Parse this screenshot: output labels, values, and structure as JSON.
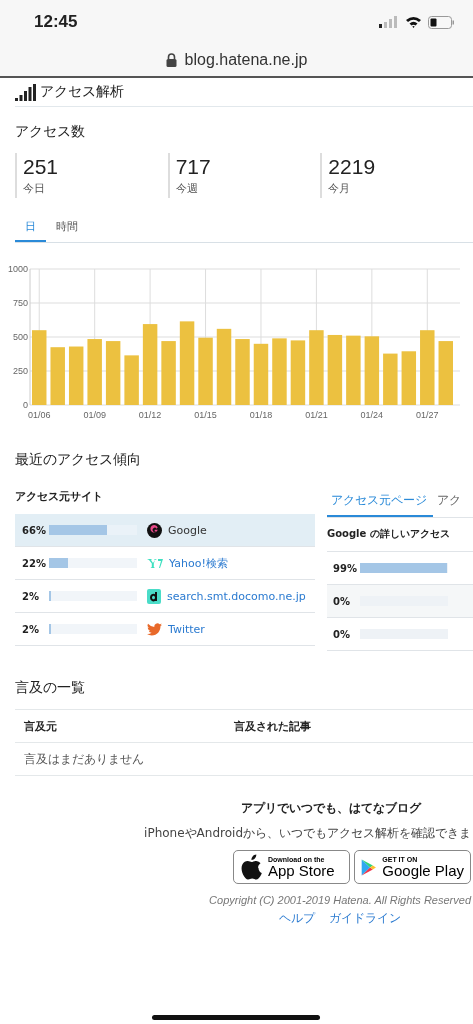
{
  "status_bar": {
    "time": "12:45"
  },
  "url_bar": {
    "url": "blog.hatena.ne.jp"
  },
  "header": {
    "title": "アクセス解析"
  },
  "access_count": {
    "title": "アクセス数",
    "stats": [
      {
        "value": "251",
        "label": "今日"
      },
      {
        "value": "717",
        "label": "今週"
      },
      {
        "value": "2219",
        "label": "今月"
      }
    ]
  },
  "tabs": [
    {
      "label": "日",
      "selected": true
    },
    {
      "label": "時間",
      "selected": false
    }
  ],
  "chart_data": {
    "type": "bar",
    "grid": true,
    "categories": [
      "01/06",
      null,
      null,
      "01/09",
      null,
      null,
      "01/12",
      null,
      null,
      "01/15",
      null,
      null,
      "01/18",
      null,
      null,
      "01/21",
      null,
      null,
      "01/24",
      null,
      null,
      "01/27",
      null
    ],
    "series": [
      {
        "color": "#ecc140",
        "values": [
          550,
          425,
          430,
          485,
          470,
          365,
          595,
          470,
          615,
          495,
          560,
          485,
          450,
          490,
          475,
          550,
          515,
          510,
          505,
          378,
          395,
          550,
          470
        ]
      }
    ],
    "ylim": [
      0,
      1000
    ],
    "yticks": [
      0,
      250,
      500,
      750,
      1000
    ]
  },
  "trends": {
    "title": "最近のアクセス傾向",
    "sources": {
      "title": "アクセス元サイト",
      "rows": [
        {
          "percent": "66%",
          "level": 0.66,
          "site": "Google",
          "kind": "google",
          "selected": true
        },
        {
          "percent": "22%",
          "level": 0.22,
          "site": "Yahoo!検索",
          "kind": "yahoo",
          "selected": false
        },
        {
          "percent": "2%",
          "level": 0.02,
          "site": "search.smt.docomo.ne.jp",
          "kind": "docomo",
          "selected": false
        },
        {
          "percent": "2%",
          "level": 0.02,
          "site": "Twitter",
          "kind": "twitter",
          "selected": false
        }
      ]
    },
    "detail": {
      "tabs": [
        {
          "label": "アクセス元ページ",
          "selected": true
        },
        {
          "label": "アク",
          "selected": false
        }
      ],
      "title": "Google の詳しいアクセス",
      "rows": [
        {
          "percent": "99%",
          "level": 0.99
        },
        {
          "percent": "0%",
          "level": 0
        },
        {
          "percent": "0%",
          "level": 0
        }
      ]
    }
  },
  "mentions": {
    "title": "言及の一覧",
    "columns": [
      "言及元",
      "言及された記事"
    ],
    "empty": "言及はまだありません"
  },
  "footer": {
    "promo_title": "アプリでいつでも、はてなブログ",
    "promo_text": "iPhoneやAndroidから、いつでもアクセス解析を確認できま",
    "stores": [
      {
        "kind": "apple",
        "small": "Download on the",
        "big": "App Store"
      },
      {
        "kind": "google",
        "small": "GET IT ON",
        "big": "Google Play"
      }
    ],
    "copyright": "Copyright (C) 2001-2019 Hatena. All Rights Reserved",
    "links": [
      "ヘルプ",
      "ガイドライン"
    ]
  }
}
